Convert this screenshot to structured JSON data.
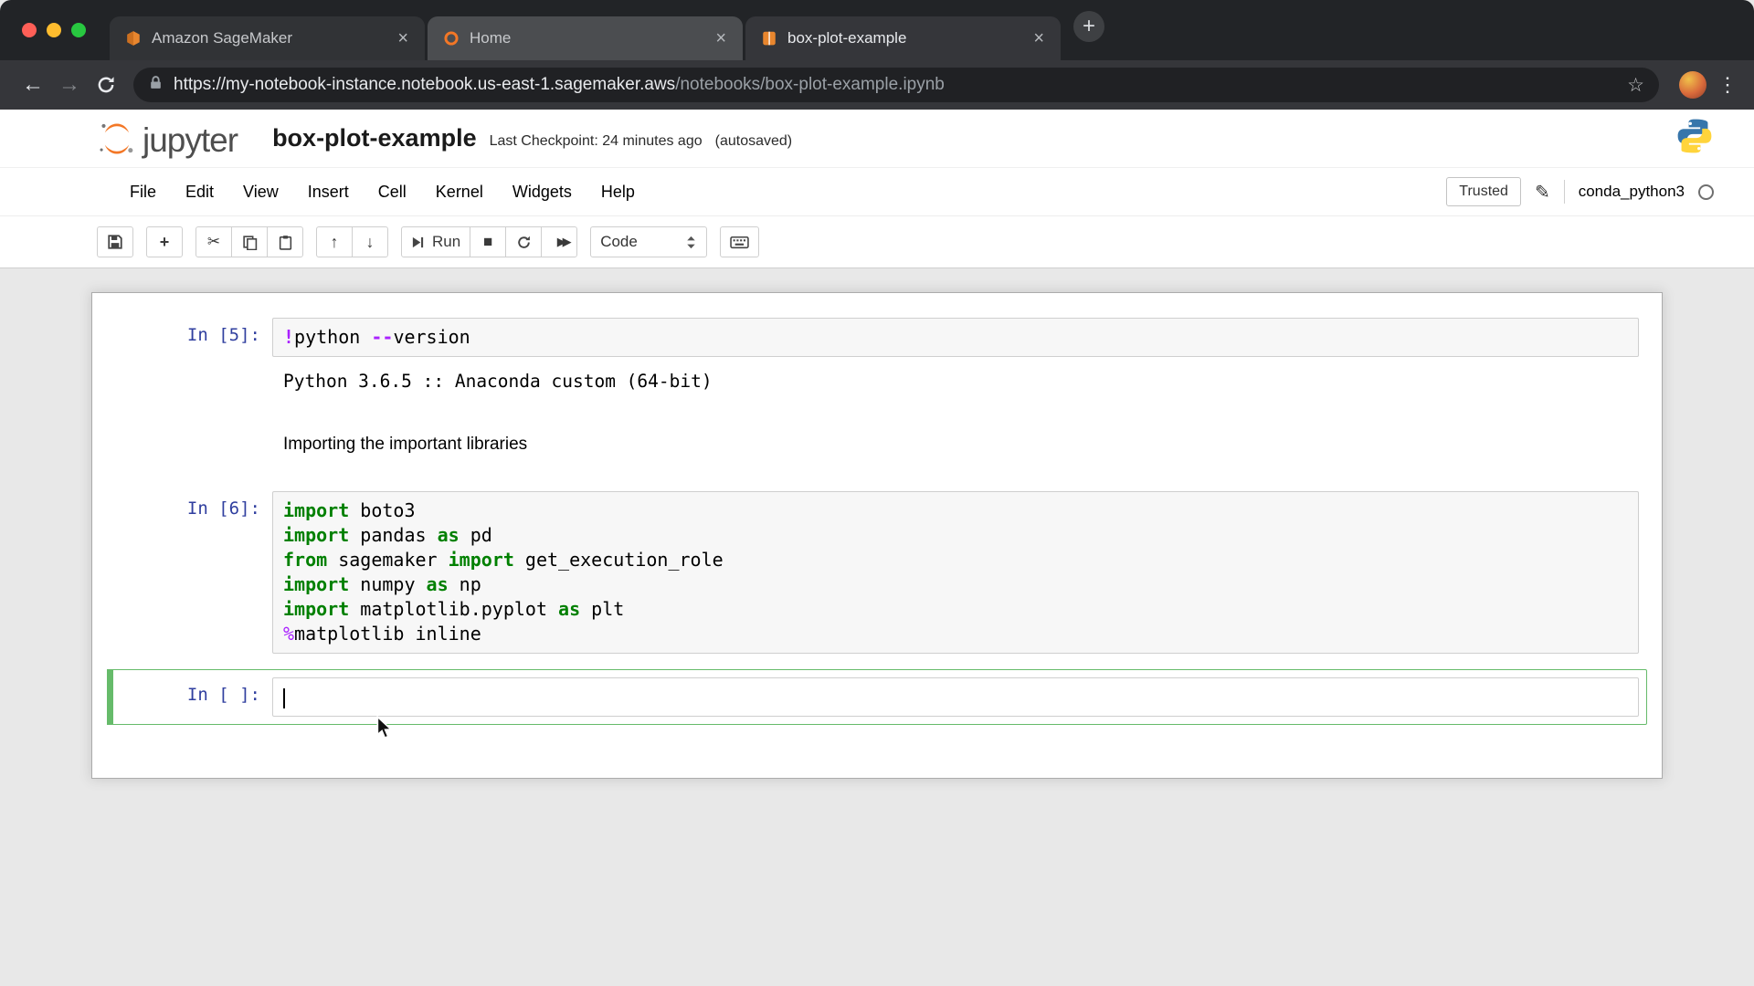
{
  "glyphs": {
    "close": "×",
    "new_tab": "+",
    "back": "←",
    "forward": "→",
    "menu_dots": "⋮",
    "star": "☆",
    "plus": "+",
    "cut": "✂",
    "arrow_up": "↑",
    "arrow_down": "↓",
    "stop": "■",
    "fast_forward": "▶▶",
    "pencil": "✎"
  },
  "browser": {
    "tabs": [
      {
        "label": "Amazon SageMaker"
      },
      {
        "label": "Home"
      },
      {
        "label": "box-plot-example"
      }
    ],
    "url": {
      "primary": "https://my-notebook-instance.notebook.us-east-1.sagemaker.aws",
      "secondary": "/notebooks/box-plot-example.ipynb"
    }
  },
  "header": {
    "logo_text": "jupyter",
    "title": "box-plot-example",
    "checkpoint": "Last Checkpoint: 24 minutes ago",
    "autosaved": "(autosaved)"
  },
  "menubar": {
    "items": [
      "File",
      "Edit",
      "View",
      "Insert",
      "Cell",
      "Kernel",
      "Widgets",
      "Help"
    ],
    "trusted_label": "Trusted",
    "kernel_name": "conda_python3"
  },
  "toolbar": {
    "run_label": "Run",
    "cell_type_selected": "Code"
  },
  "notebook": {
    "cells": [
      {
        "type": "code",
        "prompt": "In [5]:",
        "lines": [
          [
            {
              "s": "op",
              "v": "!"
            },
            {
              "s": "plain",
              "v": "python "
            },
            {
              "s": "op",
              "v": "--"
            },
            {
              "s": "plain",
              "v": "version"
            }
          ]
        ],
        "output": "Python 3.6.5 :: Anaconda custom (64-bit)"
      },
      {
        "type": "markdown",
        "text": "Importing the important libraries"
      },
      {
        "type": "code",
        "prompt": "In [6]:",
        "lines": [
          [
            {
              "s": "kw",
              "v": "import"
            },
            {
              "s": "plain",
              "v": " boto3"
            }
          ],
          [
            {
              "s": "kw",
              "v": "import"
            },
            {
              "s": "plain",
              "v": " pandas "
            },
            {
              "s": "kw",
              "v": "as"
            },
            {
              "s": "plain",
              "v": " pd"
            }
          ],
          [
            {
              "s": "kw",
              "v": "from"
            },
            {
              "s": "plain",
              "v": " sagemaker "
            },
            {
              "s": "kw",
              "v": "import"
            },
            {
              "s": "plain",
              "v": " get_execution_role"
            }
          ],
          [
            {
              "s": "kw",
              "v": "import"
            },
            {
              "s": "plain",
              "v": " numpy "
            },
            {
              "s": "kw",
              "v": "as"
            },
            {
              "s": "plain",
              "v": " np"
            }
          ],
          [
            {
              "s": "kw",
              "v": "import"
            },
            {
              "s": "plain",
              "v": " matplotlib.pyplot "
            },
            {
              "s": "kw",
              "v": "as"
            },
            {
              "s": "plain",
              "v": " plt"
            }
          ],
          [
            {
              "s": "magic",
              "v": "%"
            },
            {
              "s": "plain",
              "v": "matplotlib inline"
            }
          ]
        ]
      },
      {
        "type": "code",
        "prompt": "In [ ]:",
        "lines": [],
        "selected": true
      }
    ]
  },
  "colors": {
    "selection_green": "#66BB6A",
    "prompt_blue": "#303F9F",
    "keyword_green": "#008000",
    "operator_purple": "#AA22FF",
    "jupyter_orange": "#F37726"
  }
}
